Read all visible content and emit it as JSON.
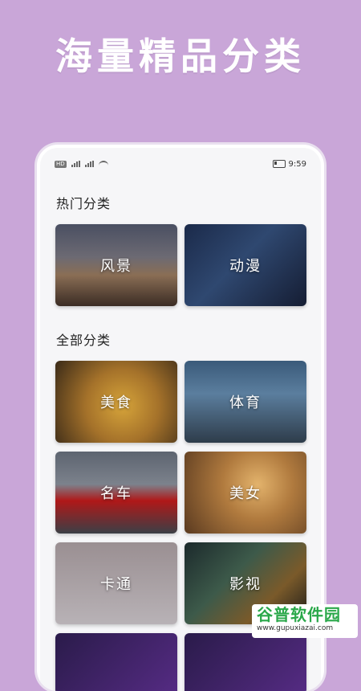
{
  "promo": {
    "title": "海量精品分类"
  },
  "status_bar": {
    "network_badge": "HD",
    "time": "9:59"
  },
  "sections": {
    "hot": {
      "title": "热门分类"
    },
    "all": {
      "title": "全部分类"
    }
  },
  "categories": {
    "hot": [
      {
        "label": "风景"
      },
      {
        "label": "动漫"
      }
    ],
    "all": [
      {
        "label": "美食"
      },
      {
        "label": "体育"
      },
      {
        "label": "名车"
      },
      {
        "label": "美女"
      },
      {
        "label": "卡通"
      },
      {
        "label": "影视"
      }
    ]
  },
  "watermark": {
    "title": "谷普软件园",
    "url": "www.gupuxiazai.com"
  }
}
